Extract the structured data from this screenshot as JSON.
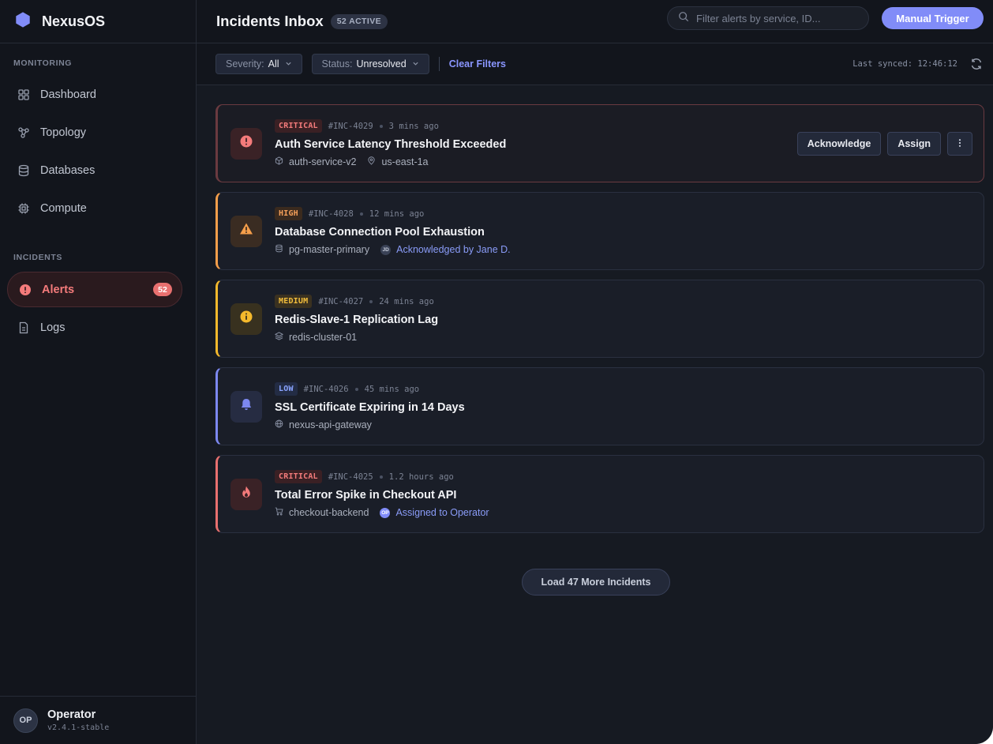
{
  "brand": {
    "name": "NexusOS",
    "accent": "#818cf8"
  },
  "sidebar": {
    "sections": [
      {
        "label": "MONITORING",
        "items": [
          {
            "label": "Dashboard",
            "icon": "grid-icon"
          },
          {
            "label": "Topology",
            "icon": "network-icon"
          },
          {
            "label": "Databases",
            "icon": "database-icon"
          },
          {
            "label": "Compute",
            "icon": "cpu-icon"
          }
        ]
      },
      {
        "label": "INCIDENTS",
        "items": [
          {
            "label": "Alerts",
            "icon": "alert-circle-icon",
            "badge": "52",
            "active": true
          },
          {
            "label": "Logs",
            "icon": "file-icon"
          }
        ]
      }
    ],
    "user": {
      "initials": "OP",
      "name": "Operator",
      "version": "v2.4.1-stable"
    }
  },
  "header": {
    "title": "Incidents Inbox",
    "active_count": "52 ACTIVE",
    "search_placeholder": "Filter alerts by service, ID...",
    "trigger_label": "Manual Trigger"
  },
  "filters": {
    "severity_key": "Severity:",
    "severity_value": "All",
    "status_key": "Status:",
    "status_value": "Unresolved",
    "clear_label": "Clear Filters",
    "synced": "Last synced: 12:46:12"
  },
  "incidents": [
    {
      "severity": "CRITICAL",
      "id": "#INC-4029",
      "time": "3 mins ago",
      "title": "Auth Service Latency Threshold Exceeded",
      "service": "auth-service-v2",
      "region": "us-east-1a"
    },
    {
      "severity": "HIGH",
      "id": "#INC-4028",
      "time": "12 mins ago",
      "title": "Database Connection Pool Exhaustion",
      "service": "pg-master-primary",
      "assignee_initials": "JD",
      "assignee_text": "Acknowledged by Jane D."
    },
    {
      "severity": "MEDIUM",
      "id": "#INC-4027",
      "time": "24 mins ago",
      "title": "Redis-Slave-1 Replication Lag",
      "service": "redis-cluster-01"
    },
    {
      "severity": "LOW",
      "id": "#INC-4026",
      "time": "45 mins ago",
      "title": "SSL Certificate Expiring in 14 Days",
      "service": "nexus-api-gateway"
    },
    {
      "severity": "CRITICAL",
      "id": "#INC-4025",
      "time": "1.2 hours ago",
      "title": "Total Error Spike in Checkout API",
      "service": "checkout-backend",
      "assignee_initials": "OP",
      "assignee_text": "Assigned to Operator"
    }
  ],
  "actions": {
    "acknowledge": "Acknowledge",
    "assign": "Assign"
  },
  "load_more": "Load 47 More Incidents",
  "colors": {
    "critical": "#e8706f",
    "high": "#f59e4a",
    "medium": "#f4b92c",
    "low": "#7c88f0"
  }
}
